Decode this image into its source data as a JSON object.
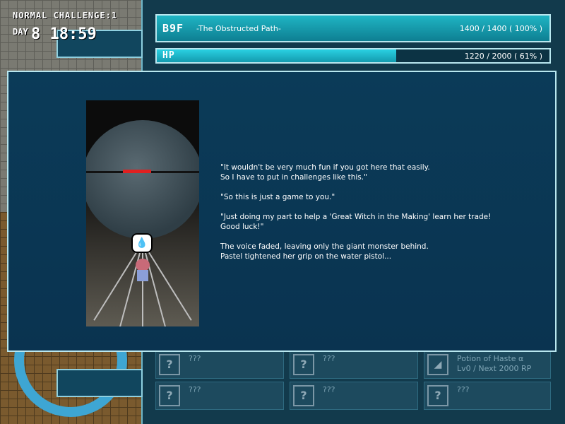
{
  "hud": {
    "mode": "NORMAL CHALLENGE:1",
    "day_label": "DAY",
    "day_value": "8",
    "time": "18:59"
  },
  "floor_bar": {
    "floor": "B9F",
    "name": "-The Obstructed Path-",
    "value": "1400 / 1400 ( 100% )",
    "progress": 1.0
  },
  "hp_bar": {
    "label": "HP",
    "value": "1220 / 2000 ( 61% )",
    "progress": 0.61
  },
  "inventory": {
    "slots": [
      {
        "name": "???",
        "detail": "",
        "icon": "unknown-icon"
      },
      {
        "name": "???",
        "detail": "",
        "icon": "unknown-icon"
      },
      {
        "name": "Potion of Haste α",
        "detail": "Lv0 / Next 2000 RP",
        "icon": "boot-icon"
      },
      {
        "name": "???",
        "detail": "",
        "icon": "unknown-icon"
      },
      {
        "name": "???",
        "detail": "",
        "icon": "unknown-icon"
      },
      {
        "name": "???",
        "detail": "",
        "icon": "unknown-icon"
      }
    ],
    "unknown_glyph": "?"
  },
  "dialog": {
    "lines": [
      [
        "\"It wouldn't be very much fun if you got here that easily.",
        "So I have to put in challenges like this.\""
      ],
      [
        "\"So this is just a game to you.\""
      ],
      [
        "\"Just doing my part to help a 'Great Witch in the Making' learn her trade!",
        "Good luck!\""
      ],
      [
        "The voice faded, leaving only the giant monster behind.",
        "Pastel tightened her grip on the water pistol..."
      ]
    ],
    "bubble_icon": "water-drop-icon"
  }
}
